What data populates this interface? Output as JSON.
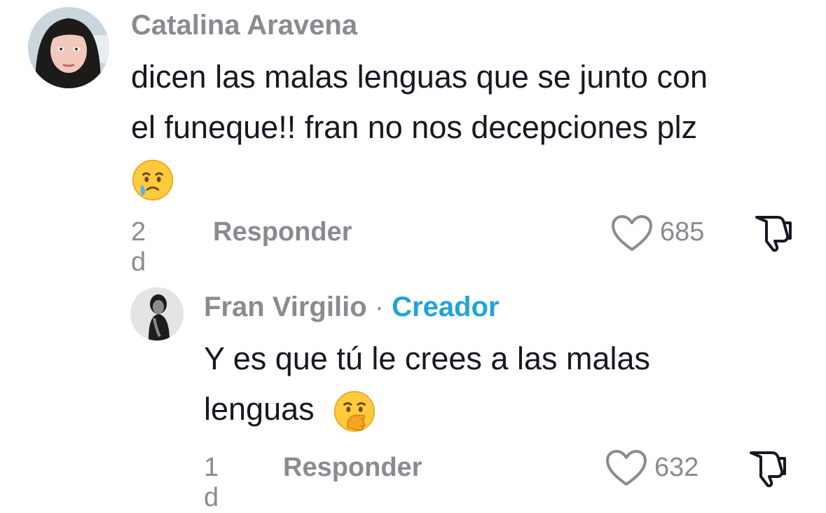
{
  "comments": [
    {
      "username": "Catalina Aravena",
      "text_line1": "dicen las malas lenguas que se junto con",
      "text_line2": "el funeque!! fran no nos decepciones plz",
      "emoji_name": "face-holding-back-tears-emoji",
      "time": "2 d",
      "reply_label": "Responder",
      "likes": "685"
    }
  ],
  "reply": {
    "username": "Fran Virgilio",
    "separator": "·",
    "badge": "Creador",
    "text_line1": "Y es que tú le crees a las malas",
    "text_line2": "lenguas",
    "emoji_name": "face-with-hand-over-mouth-emoji",
    "time": "1 d",
    "reply_label": "Responder",
    "likes": "632"
  },
  "colors": {
    "secondary_text": "#8a8b91",
    "creator_badge": "#20a4d8",
    "primary_text": "#161823"
  }
}
